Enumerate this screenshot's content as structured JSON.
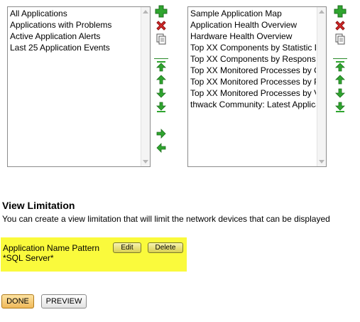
{
  "left_list": {
    "items": [
      "All Applications",
      "Applications with Problems",
      "Active Application Alerts",
      "Last 25 Application Events"
    ]
  },
  "right_list": {
    "items": [
      "Sample Application Map",
      "Application Health Overview",
      "Hardware Health Overview",
      "Top XX Components by Statistic Data",
      "Top XX Components by Response Time",
      "Top XX Monitored Processes by CPU",
      "Top XX Monitored Processes by Physical Memory",
      "Top XX Monitored Processes by Virtual Memory",
      "thwack Community: Latest Application Templates"
    ]
  },
  "icons": {
    "add": "add-plus-icon",
    "delete": "delete-x-icon",
    "copy": "copy-page-icon",
    "move_top": "move-top-arrow-icon",
    "move_up": "move-up-arrow-icon",
    "move_down": "move-down-arrow-icon",
    "move_bottom": "move-bottom-arrow-icon",
    "move_right": "move-right-arrow-icon",
    "move_left": "move-left-arrow-icon"
  },
  "colors": {
    "green": "#2fa52f",
    "red": "#d62a2a",
    "highlight": "#fafa3c",
    "done_button": "#f0b95a"
  },
  "view_limitation": {
    "title": "View Limitation",
    "description": "You can create a view limitation that will limit the network devices that can be displayed",
    "pattern_label": "Application Name Pattern",
    "pattern_value": "*SQL Server*",
    "edit_label": "Edit",
    "delete_label": "Delete"
  },
  "buttons": {
    "done": "DONE",
    "preview": "PREVIEW"
  }
}
